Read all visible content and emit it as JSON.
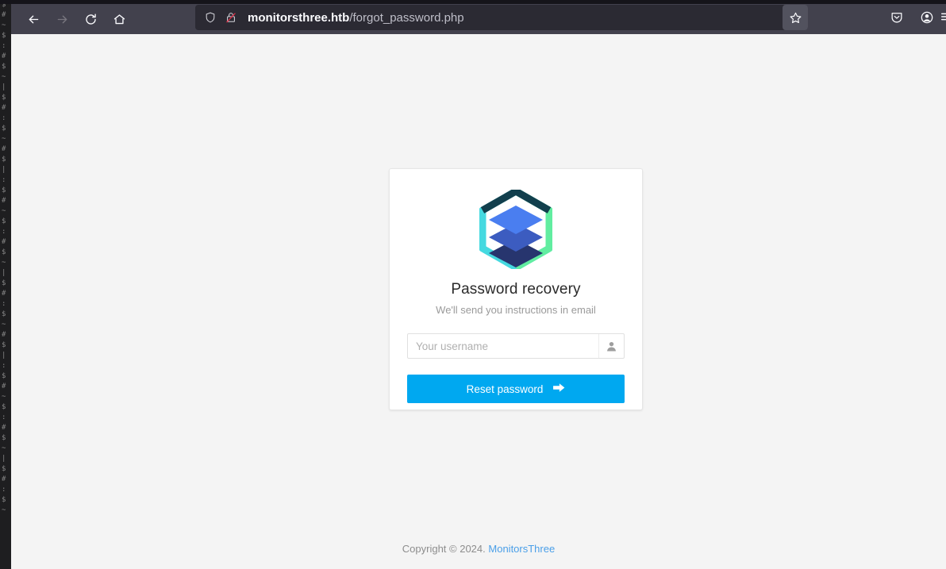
{
  "browser": {
    "nav": {
      "back_label": "Back",
      "forward_label": "Forward",
      "reload_label": "Reload",
      "home_label": "Home"
    },
    "urlbar": {
      "shield_label": "Tracking protection",
      "security_label": "Connection is not secure",
      "host": "monitorsthree.htb",
      "path": "/forgot_password.php",
      "bookmark_label": "Bookmark this page"
    },
    "toolbar_right": {
      "pocket_label": "Save to Pocket",
      "account_label": "Account"
    }
  },
  "page": {
    "card": {
      "logo_name": "monitorsthree-logo",
      "title": "Password recovery",
      "subtitle": "We'll send you instructions in email",
      "username": {
        "placeholder": "Your username",
        "value": ""
      },
      "submit_label": "Reset password"
    },
    "footer": {
      "copyright": "Copyright © 2024.",
      "brand": "MonitorsThree"
    }
  },
  "colors": {
    "accent": "#00a8f0",
    "link": "#4a9fe8",
    "page_bg": "#f4f4f4",
    "chrome_bg": "#42414d",
    "urlbar_bg": "#2b2a33",
    "logo_cyan": "#45d9e0",
    "logo_green": "#61eda0",
    "logo_dark_teal": "#123f4d",
    "logo_blue_top": "#4a7ef0",
    "logo_blue_mid": "#3c5cc0",
    "logo_blue_bottom": "#27356e"
  },
  "background_terminal": {
    "lines": [
      "$",
      "#",
      "~",
      "$",
      ":",
      "#",
      "$",
      "~",
      "|",
      "$",
      "#",
      ":",
      "$",
      "~",
      "#",
      "$",
      "|",
      ":",
      "$",
      "#",
      "~",
      "$",
      ":",
      "#",
      "$",
      "~",
      "|",
      "$",
      "#",
      ":",
      "$",
      "~",
      "#",
      "$",
      "|",
      ":",
      "$",
      "#",
      "~",
      "$",
      ":",
      "#",
      "$",
      "~",
      "|",
      "$",
      "#",
      ":",
      "$",
      "~"
    ]
  }
}
